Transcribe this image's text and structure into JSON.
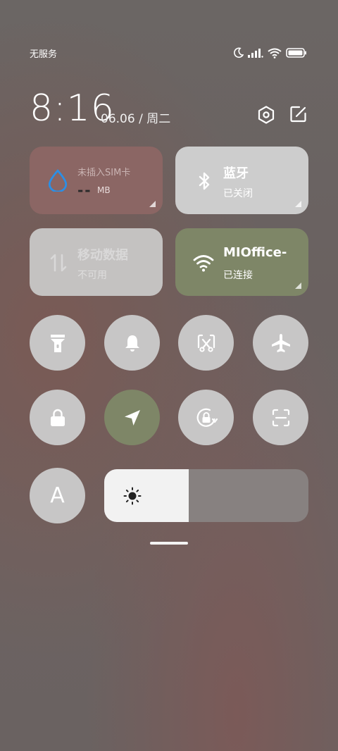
{
  "status_bar": {
    "carrier": "无服务",
    "icons": [
      "moon-icon",
      "signal-icon",
      "wifi-icon",
      "battery-icon"
    ]
  },
  "header": {
    "time": "8:16",
    "date": "06.06 / 周二",
    "icons": [
      "settings-icon",
      "edit-icon"
    ]
  },
  "tiles": {
    "sim": {
      "title": "未插入SIM卡",
      "value": "--",
      "unit": "MB",
      "icon": "water-drop-icon"
    },
    "bluetooth": {
      "title": "蓝牙",
      "subtitle": "已关闭",
      "icon": "bluetooth-icon"
    },
    "mobile_data": {
      "title": "移动数据",
      "subtitle": "不可用",
      "icon": "data-arrows-icon"
    },
    "wifi": {
      "title": "MIOffice-",
      "subtitle": "已连接",
      "icon": "wifi-icon"
    }
  },
  "toggles_row1": [
    "flashlight-icon",
    "bell-icon",
    "screenshot-icon",
    "airplane-icon"
  ],
  "toggles_row2": [
    "lock-icon",
    "location-icon",
    "rotation-lock-icon",
    "scan-icon"
  ],
  "auto_text": "A",
  "brightness": {
    "level": 0.415,
    "icon": "sun-icon"
  },
  "colors": {
    "active": "#7e8667",
    "button": "#c7c6c6",
    "sim_tile": "#8b6664"
  }
}
